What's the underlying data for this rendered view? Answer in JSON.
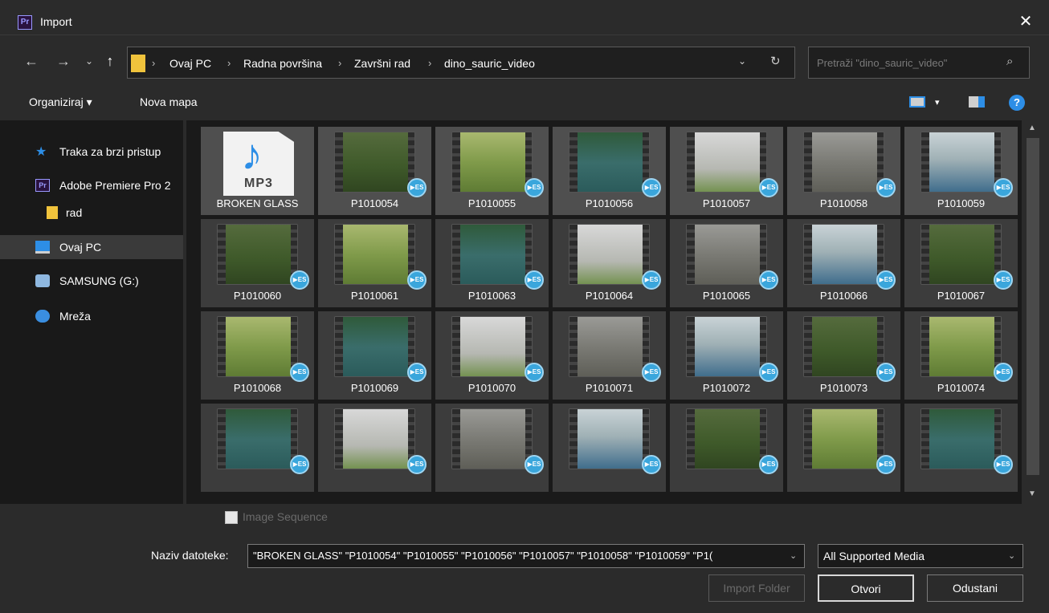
{
  "window": {
    "title": "Import",
    "app_icon": "Pr"
  },
  "nav": {
    "back": "←",
    "forward": "→",
    "recent": "⌄",
    "up": "↑"
  },
  "address": {
    "crumbs": [
      "Ovaj PC",
      "Radna površina",
      "Završni rad",
      "dino_sauric_video"
    ],
    "separator": "›"
  },
  "search": {
    "placeholder": "Pretraži \"dino_sauric_video\""
  },
  "toolbar": {
    "organize": "Organiziraj ▾",
    "new_folder": "Nova mapa",
    "help": "?"
  },
  "sidebar": {
    "items": [
      {
        "label": "Traka za brzi pristup",
        "icon": "star-icon"
      },
      {
        "label": "Adobe Premiere Pro 2",
        "icon": "premiere-icon"
      },
      {
        "label": "rad",
        "icon": "folder-icon"
      },
      {
        "label": "Ovaj PC",
        "icon": "computer-icon",
        "selected": true
      },
      {
        "label": "SAMSUNG (G:)",
        "icon": "drive-icon"
      },
      {
        "label": "Mreža",
        "icon": "network-icon"
      }
    ]
  },
  "files": [
    "BROKEN GLASS",
    "P1010054",
    "P1010055",
    "P1010056",
    "P1010057",
    "P1010058",
    "P1010059",
    "P1010060",
    "P1010061",
    "P1010063",
    "P1010064",
    "P1010065",
    "P1010066",
    "P1010067",
    "P1010068",
    "P1010069",
    "P1010070",
    "P1010071",
    "P1010072",
    "P1010073",
    "P1010074",
    "",
    "",
    "",
    "",
    "",
    "",
    ""
  ],
  "file_badge": "▶ES",
  "mp3_label": "MP3",
  "image_sequence": {
    "label": "Image Sequence",
    "checked": false,
    "enabled": false
  },
  "filename": {
    "label": "Naziv datoteke:",
    "value": "\"BROKEN GLASS\" \"P1010054\" \"P1010055\" \"P1010056\" \"P1010057\" \"P1010058\" \"P1010059\" \"P1("
  },
  "filetype": {
    "value": "All Supported Media"
  },
  "buttons": {
    "import_folder": "Import Folder",
    "open": "Otvori",
    "cancel": "Odustani"
  },
  "colors": {
    "accent": "#2d8ee6",
    "folder": "#f0c33c",
    "badge": "#3aa6dc"
  }
}
